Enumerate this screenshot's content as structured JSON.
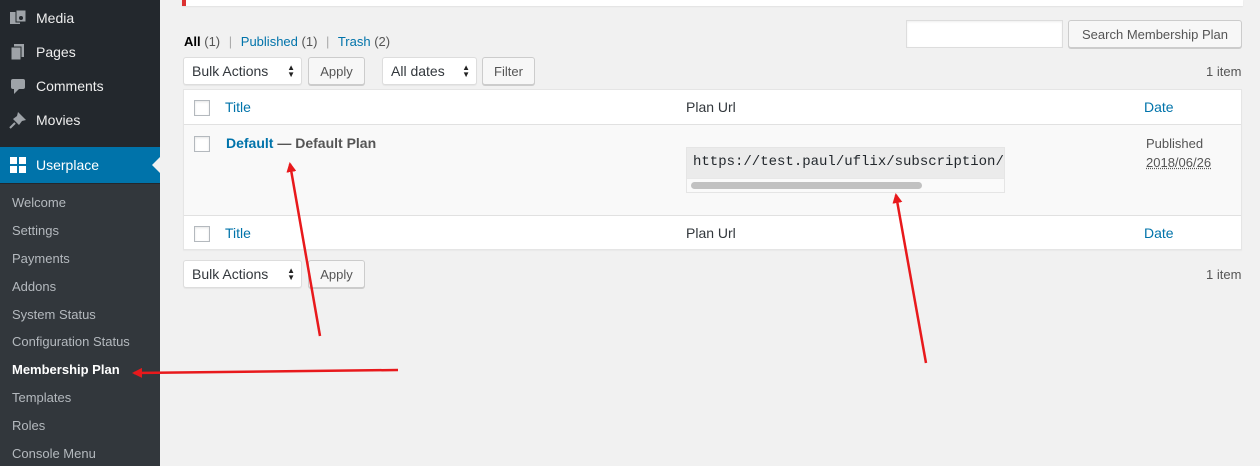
{
  "sidebar": {
    "top_items": [
      {
        "label": "Media",
        "icon": "media-icon"
      },
      {
        "label": "Pages",
        "icon": "pages-icon"
      },
      {
        "label": "Comments",
        "icon": "comments-icon"
      },
      {
        "label": "Movies",
        "icon": "pin-icon"
      }
    ],
    "current": {
      "label": "Userplace",
      "icon": "grid-icon"
    },
    "submenu": [
      "Welcome",
      "Settings",
      "Payments",
      "Addons",
      "System Status",
      "Configuration Status",
      "Membership Plan",
      "Templates",
      "Roles",
      "Console Menu"
    ]
  },
  "views": {
    "all": "All",
    "all_count": "(1)",
    "published": "Published",
    "published_count": "(1)",
    "trash": "Trash",
    "trash_count": "(2)",
    "separator": "|"
  },
  "search": {
    "button": "Search Membership Plan",
    "value": ""
  },
  "top_nav": {
    "bulk": "Bulk Actions",
    "apply": "Apply",
    "dates": "All dates",
    "filter": "Filter",
    "count": "1 item"
  },
  "bottom_nav": {
    "bulk": "Bulk Actions",
    "apply": "Apply",
    "count": "1 item"
  },
  "table": {
    "columns": {
      "title": "Title",
      "plan_url": "Plan Url",
      "date": "Date"
    },
    "rows": [
      {
        "title": "Default",
        "state": "— Default Plan",
        "plan_url": "https://test.paul/uflix/subscription/payment",
        "status": "Published",
        "date": "2018/06/26"
      }
    ]
  },
  "colors": {
    "accent": "#0073aa",
    "annotation": "#e8191c",
    "sidebar": "#23282d"
  }
}
